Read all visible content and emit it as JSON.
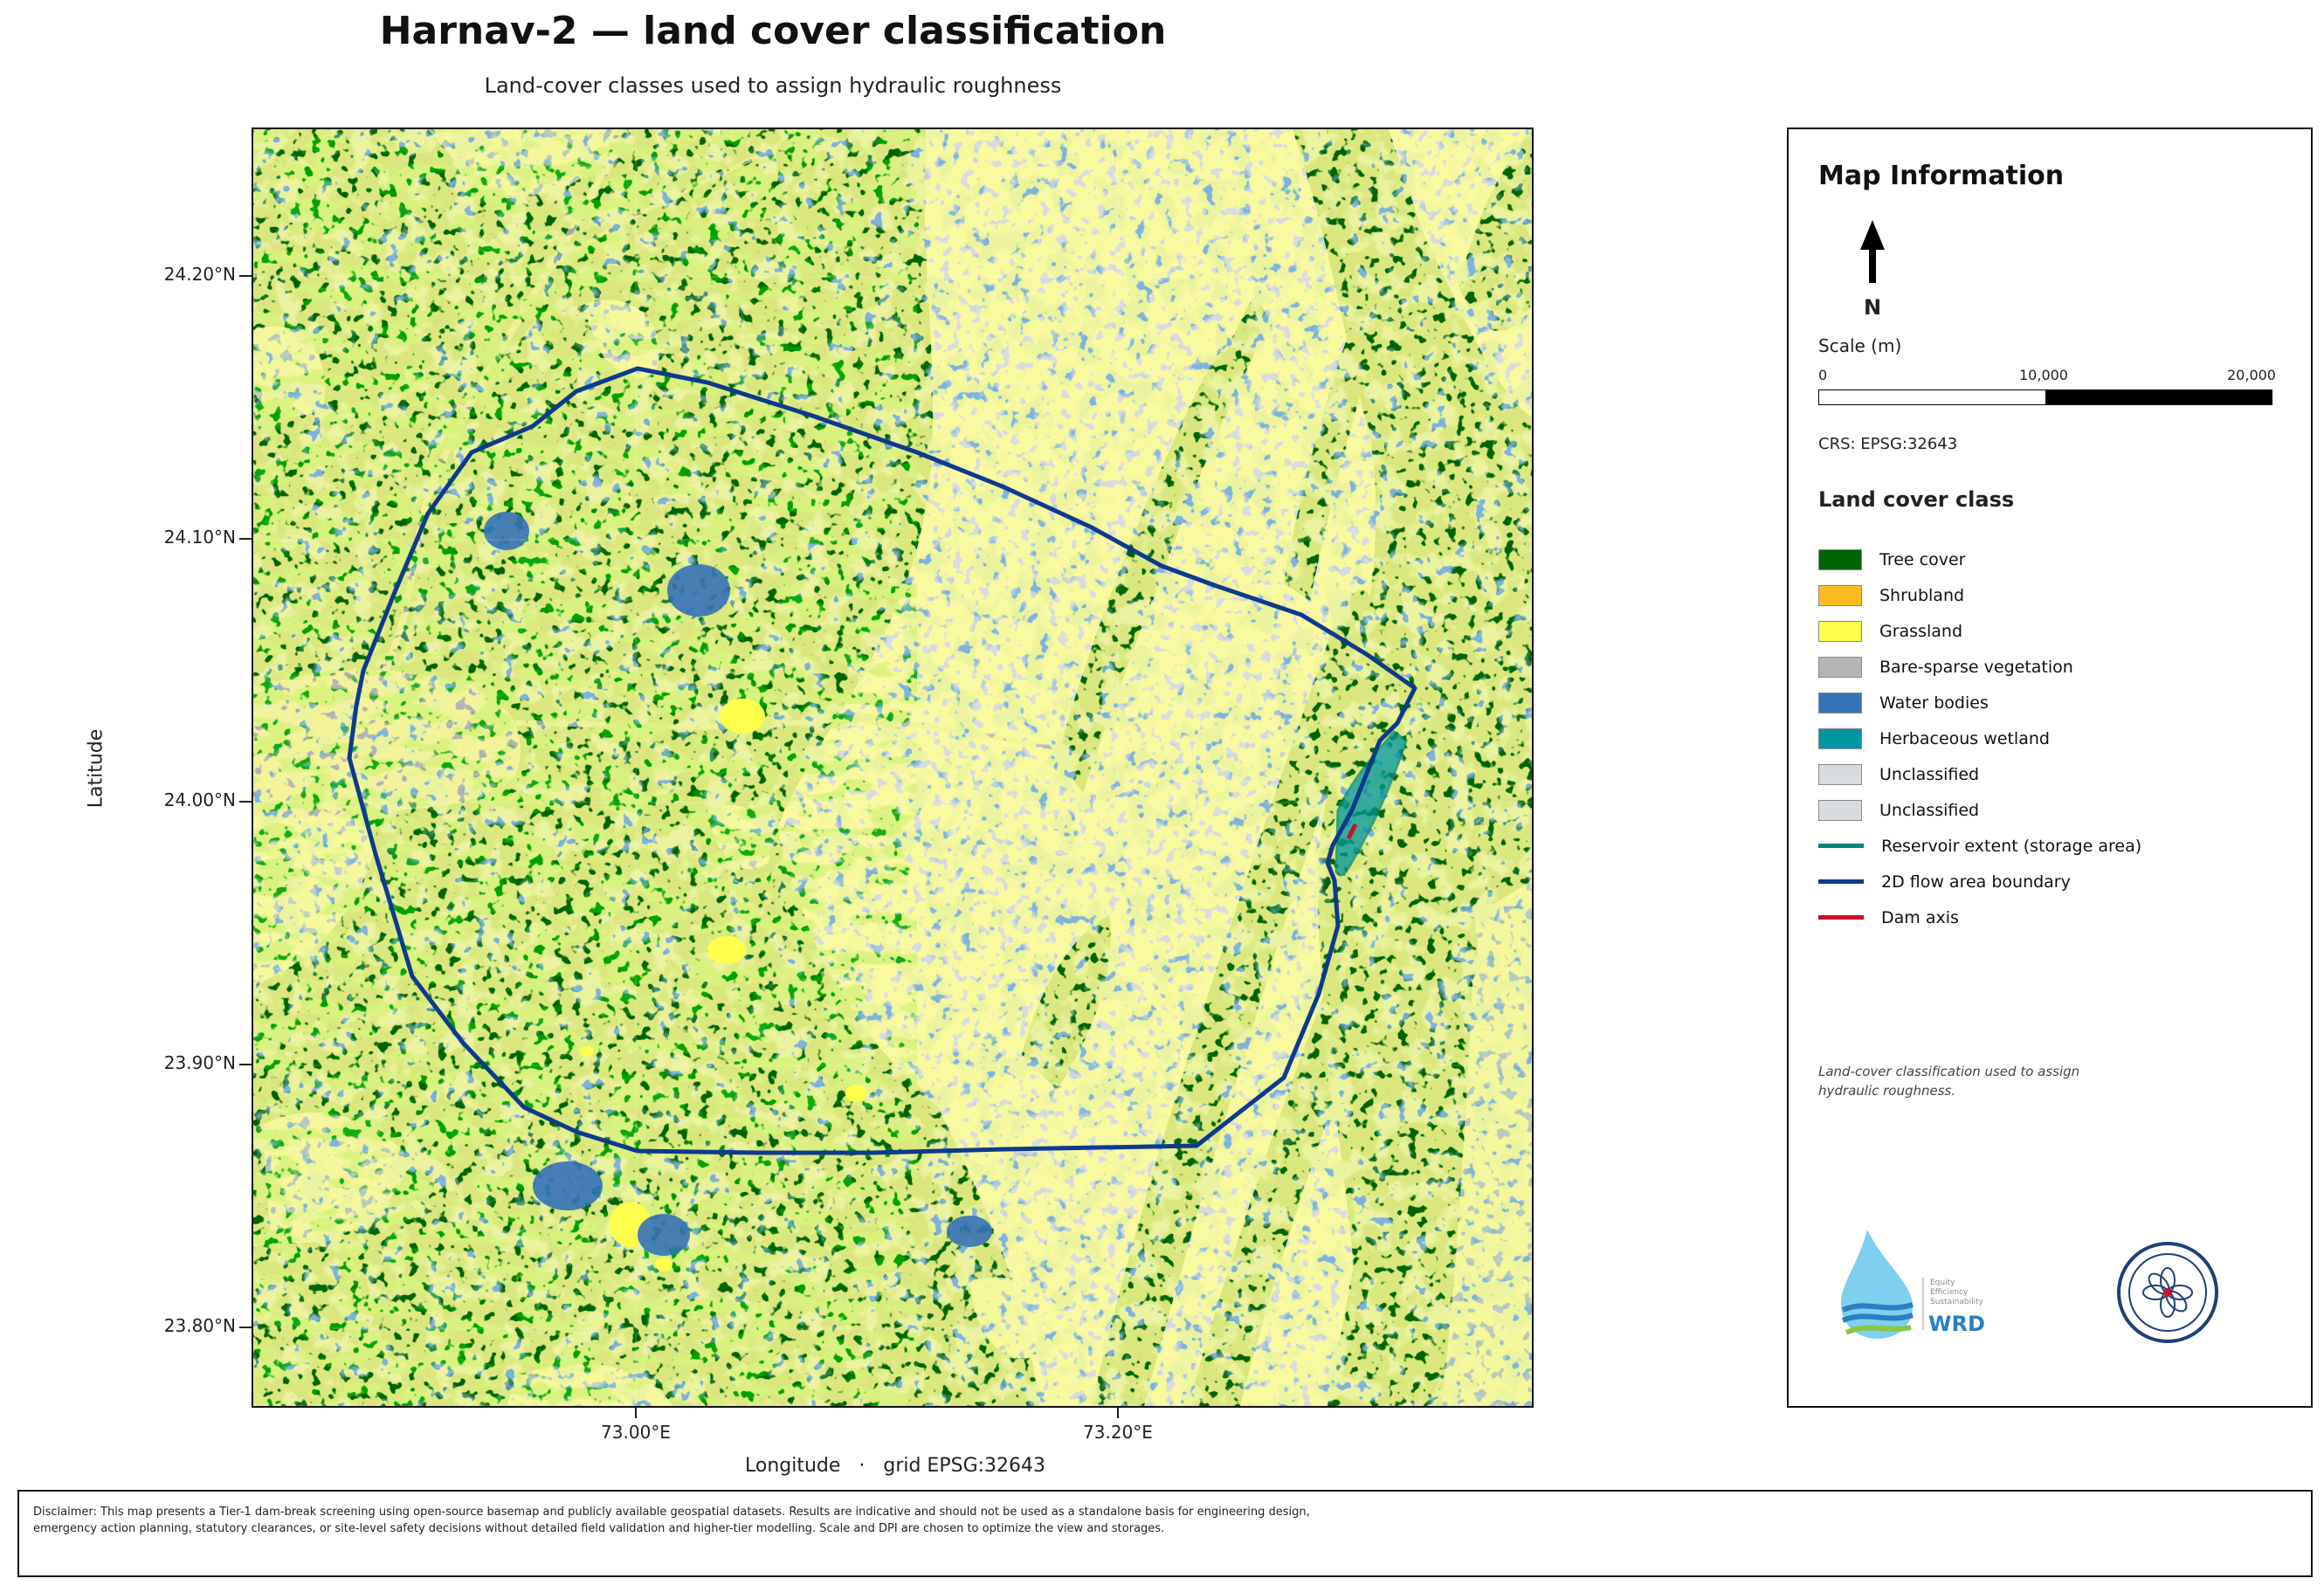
{
  "title": "Harnav-2 — land cover classification",
  "subtitle": "Land-cover classes used to assign hydraulic roughness",
  "axes": {
    "ylabel": "Latitude",
    "xlabel": "Longitude   ·   grid EPSG:32643",
    "yticks": [
      "24.20°N",
      "24.10°N",
      "24.00°N",
      "23.90°N",
      "23.80°N"
    ],
    "xticks": [
      "73.00°E",
      "73.20°E"
    ]
  },
  "panel": {
    "title": "Map Information",
    "north_label": "N",
    "scale_title": "Scale (m)",
    "scale_labels": [
      "0",
      "10,000",
      "20,000"
    ],
    "crs": "CRS: EPSG:32643",
    "legend_title": "Land cover class",
    "note": "Land-cover classification used to assign hydraulic roughness.",
    "logo_text": [
      "Equity",
      "Efficiency",
      "Sustainability",
      "WRD"
    ]
  },
  "legend": [
    {
      "label": "Tree cover",
      "color": "#006400",
      "kind": "fill"
    },
    {
      "label": "Shrubland",
      "color": "#ffbb22",
      "kind": "fill"
    },
    {
      "label": "Grassland",
      "color": "#ffff4c",
      "kind": "fill"
    },
    {
      "label": "Bare-sparse vegetation",
      "color": "#b4b4b4",
      "kind": "fill"
    },
    {
      "label": "Water bodies",
      "color": "#3572b8",
      "kind": "fill"
    },
    {
      "label": "Herbaceous wetland",
      "color": "#0096a0",
      "kind": "fill"
    },
    {
      "label": "Unclassified",
      "color": "#d9dcdf",
      "kind": "fill"
    },
    {
      "label": "Unclassified",
      "color": "#d9dcdf",
      "kind": "fill"
    },
    {
      "label": "Reservoir extent (storage area)",
      "color": "#008577",
      "kind": "line"
    },
    {
      "label": "2D flow area boundary",
      "color": "#0d3a8c",
      "kind": "line"
    },
    {
      "label": "Dam axis",
      "color": "#c8102e",
      "kind": "line"
    }
  ],
  "disclaimer": "Disclaimer: This map presents a Tier-1 dam-break screening using open-source basemap and publicly available geospatial datasets. Results are indicative and should not be used as a standalone basis for engineering design, emergency action planning, statutory clearances, or site-level safety decisions without detailed field validation and higher-tier modelling. Scale and DPI are chosen to optimize the view and storages."
}
